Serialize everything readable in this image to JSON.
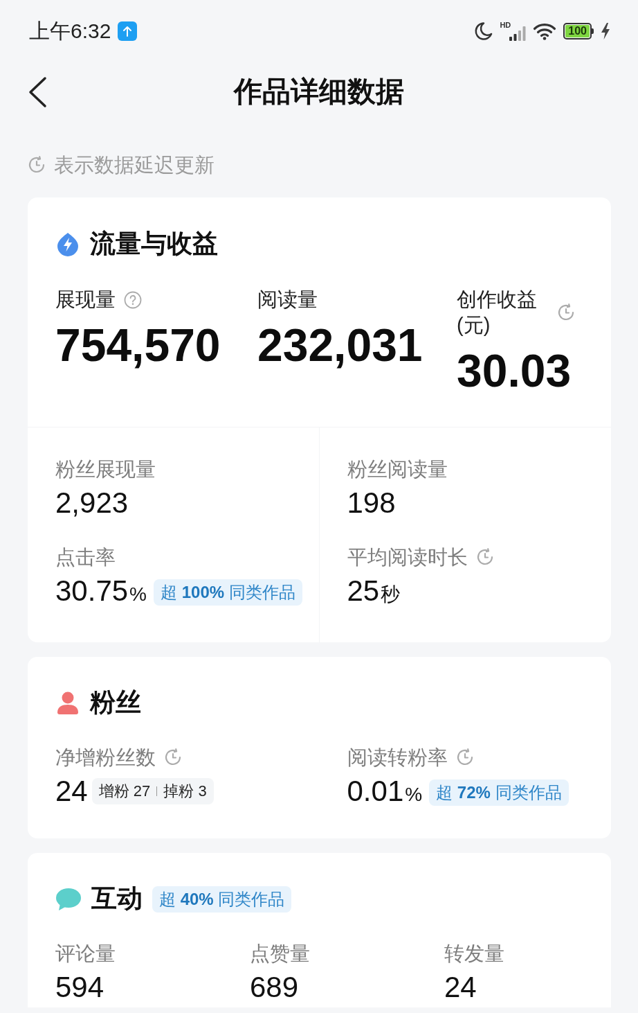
{
  "status_bar": {
    "time": "上午6:32",
    "network": "HD",
    "battery": "100"
  },
  "header": {
    "title": "作品详细数据"
  },
  "notice": {
    "text": "表示数据延迟更新"
  },
  "sections": [
    {
      "kind": "traffic",
      "title": "流量与收益",
      "headline": [
        {
          "label": "展现量",
          "help": true,
          "delayed": false,
          "value": "754,570"
        },
        {
          "label": "阅读量",
          "help": false,
          "delayed": false,
          "value": "232,031"
        },
        {
          "label": "创作收益(元)",
          "help": false,
          "delayed": true,
          "value": "30.03"
        }
      ],
      "metrics": [
        {
          "label": "粉丝展现量",
          "delayed": false,
          "value": "2,923"
        },
        {
          "label": "粉丝阅读量",
          "delayed": false,
          "value": "198"
        },
        {
          "label": "点击率",
          "delayed": false,
          "value": "30.75",
          "unit": "%",
          "badge": "超 **100%** 同类作品"
        },
        {
          "label": "平均阅读时长",
          "delayed": true,
          "value": "25",
          "unit": "秒"
        }
      ]
    },
    {
      "kind": "fans",
      "title": "粉丝",
      "metrics": [
        {
          "label": "净增粉丝数",
          "delayed": true,
          "value": "24",
          "breakdown": [
            "增粉 27",
            "掉粉 3"
          ]
        },
        {
          "label": "阅读转粉率",
          "delayed": true,
          "value": "0.01",
          "unit": "%",
          "badge": "超 **72%** 同类作品"
        }
      ]
    },
    {
      "kind": "interaction",
      "title": "互动",
      "badge": "超 **40%** 同类作品",
      "metrics": [
        {
          "label": "评论量",
          "delayed": false,
          "value": "594"
        },
        {
          "label": "点赞量",
          "delayed": false,
          "value": "689"
        },
        {
          "label": "转发量",
          "delayed": false,
          "value": "24"
        }
      ]
    }
  ]
}
